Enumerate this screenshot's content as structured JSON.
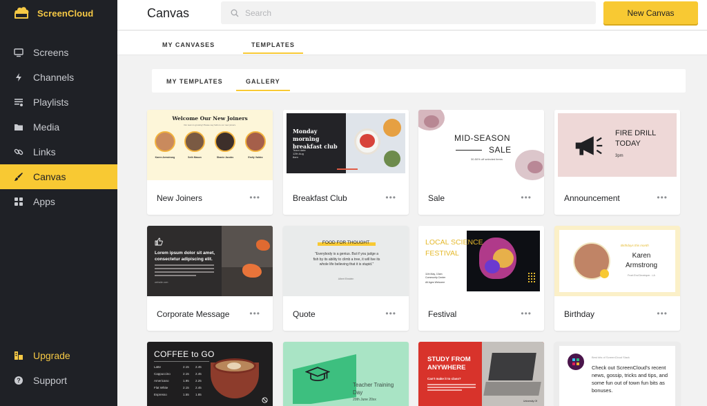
{
  "app": {
    "brand": "ScreenCloud"
  },
  "sidebar": {
    "items": [
      {
        "label": "Screens",
        "icon": "screen-icon"
      },
      {
        "label": "Channels",
        "icon": "lightning-icon"
      },
      {
        "label": "Playlists",
        "icon": "playlist-icon"
      },
      {
        "label": "Media",
        "icon": "folder-icon"
      },
      {
        "label": "Links",
        "icon": "link-icon"
      },
      {
        "label": "Canvas",
        "icon": "brush-icon",
        "active": true
      },
      {
        "label": "Apps",
        "icon": "apps-grid-icon"
      }
    ],
    "bottom": [
      {
        "label": "Upgrade",
        "icon": "upgrade-icon"
      },
      {
        "label": "Support",
        "icon": "help-icon"
      }
    ]
  },
  "header": {
    "title": "Canvas",
    "search_placeholder": "Search",
    "new_button": "New Canvas"
  },
  "tabs": {
    "main": [
      {
        "label": "MY CANVASES"
      },
      {
        "label": "TEMPLATES",
        "active": true
      }
    ],
    "sub": [
      {
        "label": "MY TEMPLATES"
      },
      {
        "label": "GALLERY",
        "active": true
      }
    ]
  },
  "more_label": "•••",
  "cards": [
    {
      "title": "New Joiners",
      "thumb": {
        "heading": "Welcome Our New Joiners",
        "subheading": "Our team is growing! Please say hello to our new joiners.",
        "people": [
          {
            "name": "Karen Armstrong"
          },
          {
            "name": "Seth Mason"
          },
          {
            "name": "Shaniz Jacobs"
          },
          {
            "name": "Emily Valdez"
          }
        ]
      }
    },
    {
      "title": "Breakfast Club",
      "thumb": {
        "heading": "Monday morning breakfast club",
        "line1": "Team date",
        "line2": "12th Aug",
        "line3": "8am"
      }
    },
    {
      "title": "Sale",
      "thumb": {
        "heading": "MID-SEASON",
        "heading2": "SALE",
        "sub": "30-50% off selected items"
      }
    },
    {
      "title": "Announcement",
      "thumb": {
        "heading": "FIRE DRILL",
        "heading2": "TODAY",
        "sub": "3pm"
      }
    },
    {
      "title": "Corporate Message",
      "thumb": {
        "heading": "Lorem ipsum dolor sit amet, consectetur adipiscing elit.",
        "footer": "website.com"
      }
    },
    {
      "title": "Quote",
      "thumb": {
        "tag": "FOOD FOR THOUGHT",
        "quote": "\"Everybody is a genius. But if you judge a fish by its ability to climb a tree, it will live its whole life believing that it is stupid.\"",
        "author": "Albert Einstein"
      }
    },
    {
      "title": "Festival",
      "thumb": {
        "heading": "LOCAL SCIENCE",
        "heading2": "FESTIVAL",
        "line1": "11th May, 10am",
        "line2": "Community Center",
        "line3": "All Ages Welcome"
      }
    },
    {
      "title": "Birthday",
      "thumb": {
        "tag": "Birthdays this month",
        "name": "Karen",
        "name2": "Armstrong",
        "role": "Front End Developer - LA"
      }
    },
    {
      "title": "",
      "thumb": {
        "heading": "COFFEE to GO",
        "menu": [
          {
            "item": "Latte",
            "price1": "2.15",
            "price2": "2.45"
          },
          {
            "item": "Cappuccino",
            "price1": "2.15",
            "price2": "2.45"
          },
          {
            "item": "Americano",
            "price1": "1.95",
            "price2": "2.25"
          },
          {
            "item": "Flat White",
            "price1": "2.15",
            "price2": "2.45"
          },
          {
            "item": "Espresso",
            "price1": "1.55",
            "price2": "1.85"
          }
        ]
      }
    },
    {
      "title": "",
      "thumb": {
        "heading": "Teacher Training",
        "heading2": "Day",
        "sub": "20th June 20xx"
      }
    },
    {
      "title": "",
      "thumb": {
        "heading": "STUDY FROM",
        "heading2": "ANYWHERE",
        "sub": "Can't make it to class?",
        "footer": "University Of"
      }
    },
    {
      "title": "",
      "thumb": {
        "tag": "Best bits of ScreenCloud Slack",
        "body": "Check out ScreenCloud's recent news, gossip, tricks and tips, and some fun out of town fun bits as bonuses."
      }
    }
  ],
  "colors": {
    "accent": "#f8c933",
    "sidebar": "#1f2126",
    "background": "#f2f2f2"
  }
}
